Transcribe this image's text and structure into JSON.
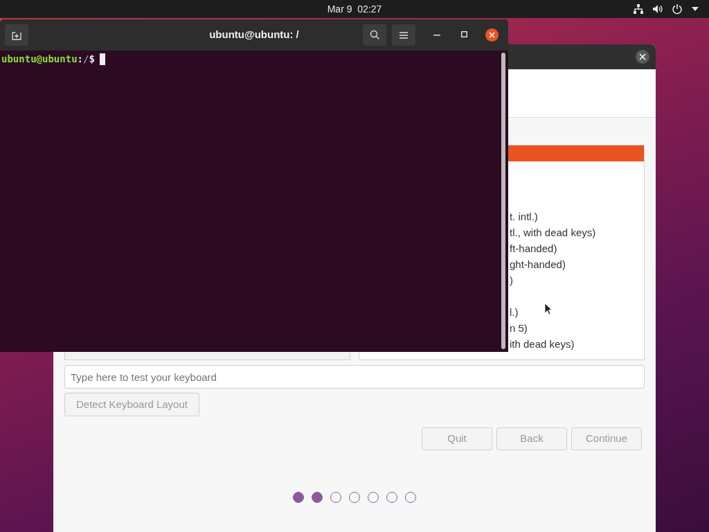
{
  "top_bar": {
    "date": "Mar 9",
    "time": "02:27"
  },
  "installer": {
    "variant_list": {
      "rows": [
        {
          "selected": true,
          "kind": "hidden"
        },
        {
          "selected": false,
          "kind": "hidden"
        },
        {
          "selected": false,
          "kind": "hidden"
        },
        {
          "selected": false,
          "kind": "hidden"
        },
        {
          "selected": false,
          "kind": "partial",
          "text": "t. intl.)"
        },
        {
          "selected": false,
          "kind": "partial",
          "text": "tl., with dead keys)"
        },
        {
          "selected": false,
          "kind": "partial",
          "text": "ft-handed)"
        },
        {
          "selected": false,
          "kind": "partial",
          "text": "ght-handed)"
        },
        {
          "selected": false,
          "kind": "partial",
          "text": ")"
        },
        {
          "selected": false,
          "kind": "hidden"
        },
        {
          "selected": false,
          "kind": "partial",
          "text": "l.)"
        },
        {
          "selected": false,
          "kind": "partial",
          "text": "n 5)"
        },
        {
          "selected": false,
          "kind": "partial",
          "text": "ith dead keys)"
        }
      ]
    },
    "test_field": {
      "placeholder": "Type here to test your keyboard"
    },
    "detect_button": "Detect Keyboard Layout",
    "buttons": [
      "Quit",
      "Back",
      "Continue"
    ],
    "steps": [
      {
        "done": true
      },
      {
        "done": true
      },
      {
        "done": false
      },
      {
        "done": false
      },
      {
        "done": false
      },
      {
        "done": false
      },
      {
        "done": false
      }
    ]
  },
  "terminal": {
    "title": "ubuntu@ubuntu: /",
    "prompt": [
      {
        "kind": "user",
        "text": "ubuntu@ubuntu"
      },
      {
        "kind": "plain",
        "text": ":"
      },
      {
        "kind": "path",
        "text": "/"
      },
      {
        "kind": "plain",
        "text": "$"
      }
    ]
  }
}
